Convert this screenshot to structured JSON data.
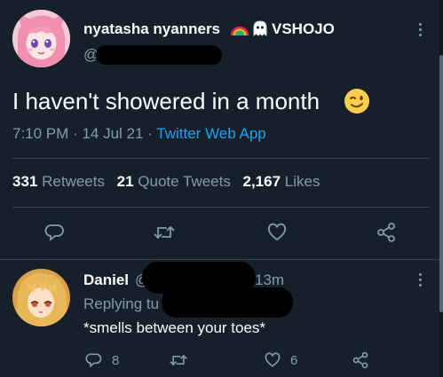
{
  "tweet": {
    "author_name": "nyatasha nyanners",
    "author_badge": "VSHOJO",
    "handle_prefix": "@",
    "text": "I haven't showered in a month",
    "emoji": "winking-face",
    "time": "7:10 PM",
    "date": "14 Jul 21",
    "source": "Twitter Web App",
    "retweets_count": "331",
    "retweets_label": "Retweets",
    "quote_tweets_count": "21",
    "quote_tweets_label": "Quote Tweets",
    "likes_count": "2,167",
    "likes_label": "Likes"
  },
  "reply": {
    "author_name": "Daniel",
    "handle_prefix": "@",
    "time_ago": "13m",
    "replying_to_prefix": "Replying tu",
    "text": "*smells between your toes*",
    "reply_count": "8",
    "like_count": "6"
  },
  "colors": {
    "background": "#15202b",
    "muted_text": "#8899a6",
    "link": "#1da1f2",
    "divider": "#38444d"
  }
}
